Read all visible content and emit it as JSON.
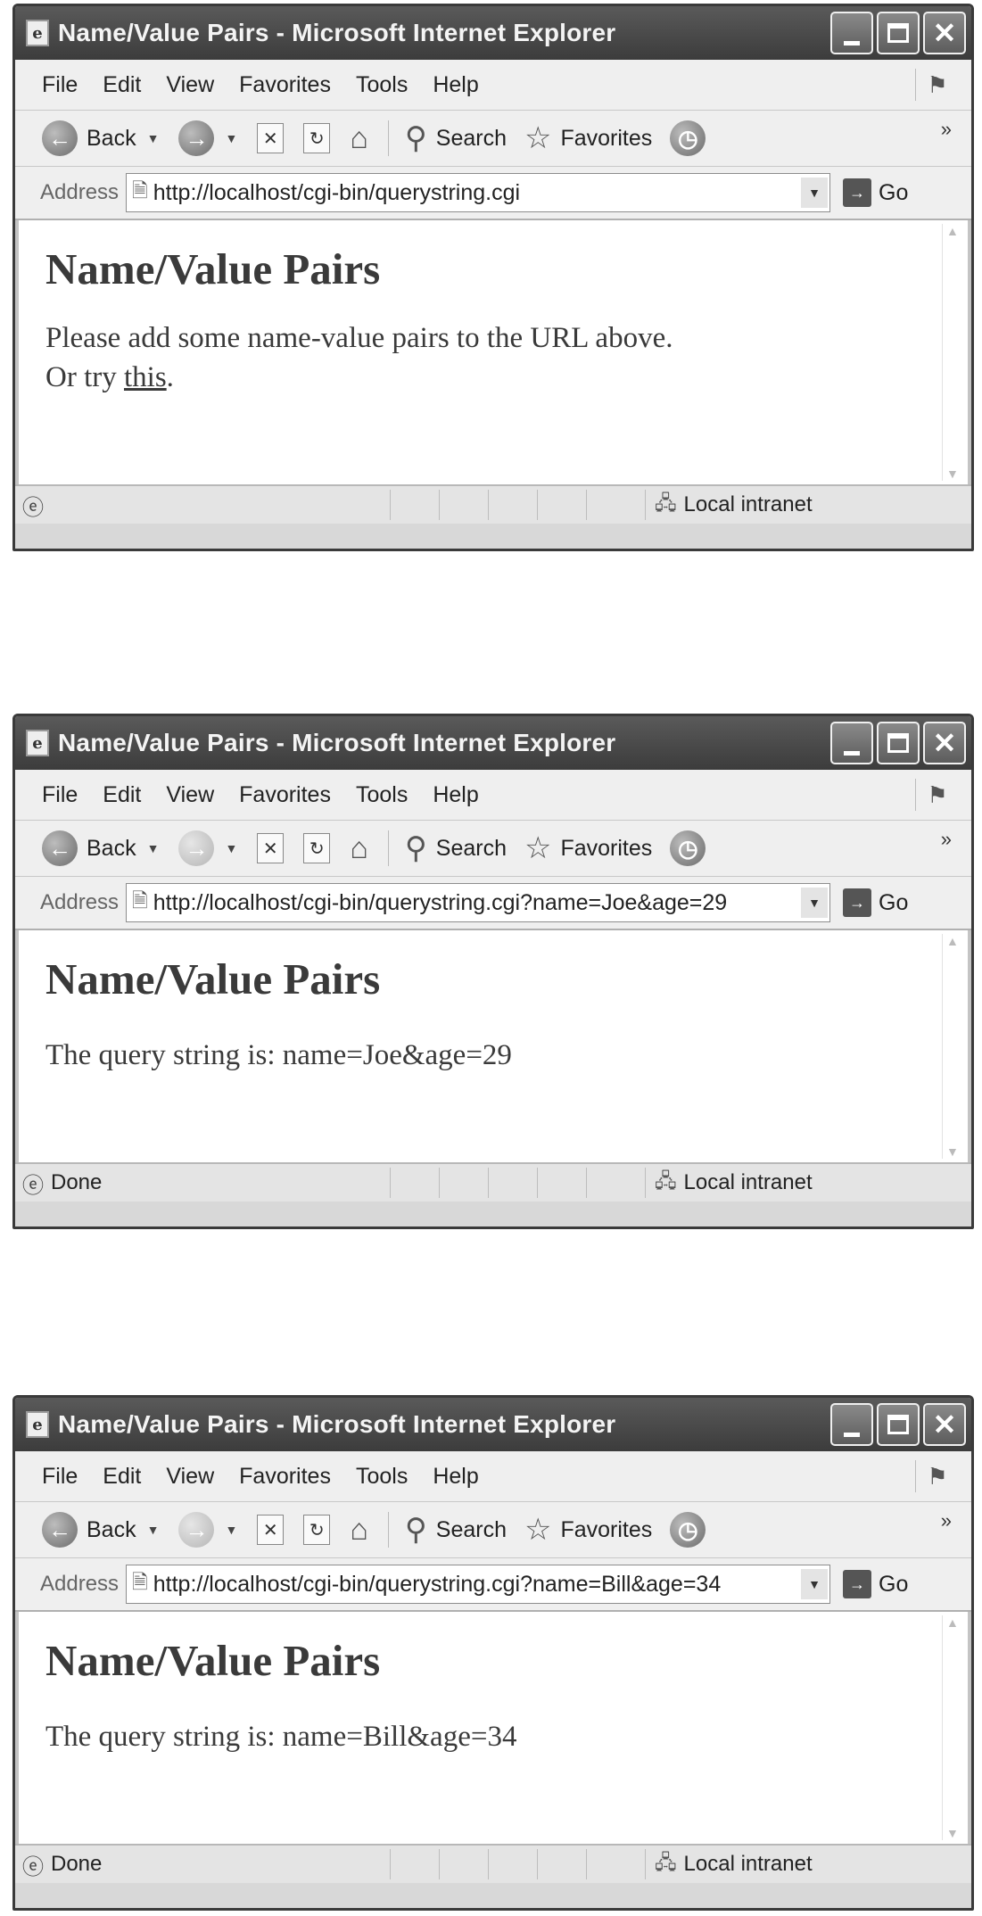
{
  "browser": {
    "title": "Name/Value Pairs - Microsoft Internet Explorer",
    "menu": [
      "File",
      "Edit",
      "View",
      "Favorites",
      "Tools",
      "Help"
    ],
    "toolbar": {
      "back": "Back",
      "search": "Search",
      "favorites": "Favorites"
    },
    "address_label": "Address",
    "go_label": "Go",
    "zone": "Local intranet",
    "icons": [
      "ie-page-icon",
      "minimize-icon",
      "maximize-icon",
      "close-icon",
      "windows-flag-icon",
      "back-arrow-icon",
      "forward-arrow-icon",
      "stop-icon",
      "refresh-icon",
      "home-icon",
      "search-icon",
      "favorites-star-icon",
      "history-icon",
      "go-arrow-icon",
      "local-intranet-icon"
    ]
  },
  "windows": [
    {
      "url": "http://localhost/cgi-bin/querystring.cgi",
      "status": "",
      "heading": "Name/Value Pairs",
      "line1": "Please add some name-value pairs to the URL above.",
      "line2_prefix": "Or try ",
      "line2_link": "this",
      "line2_suffix": "."
    },
    {
      "url": "http://localhost/cgi-bin/querystring.cgi?name=Joe&age=29",
      "status": "Done",
      "heading": "Name/Value Pairs",
      "text": "The query string is: name=Joe&age=29"
    },
    {
      "url": "http://localhost/cgi-bin/querystring.cgi?name=Bill&age=34",
      "status": "Done",
      "heading": "Name/Value Pairs",
      "text": "The query string is: name=Bill&age=34"
    }
  ]
}
